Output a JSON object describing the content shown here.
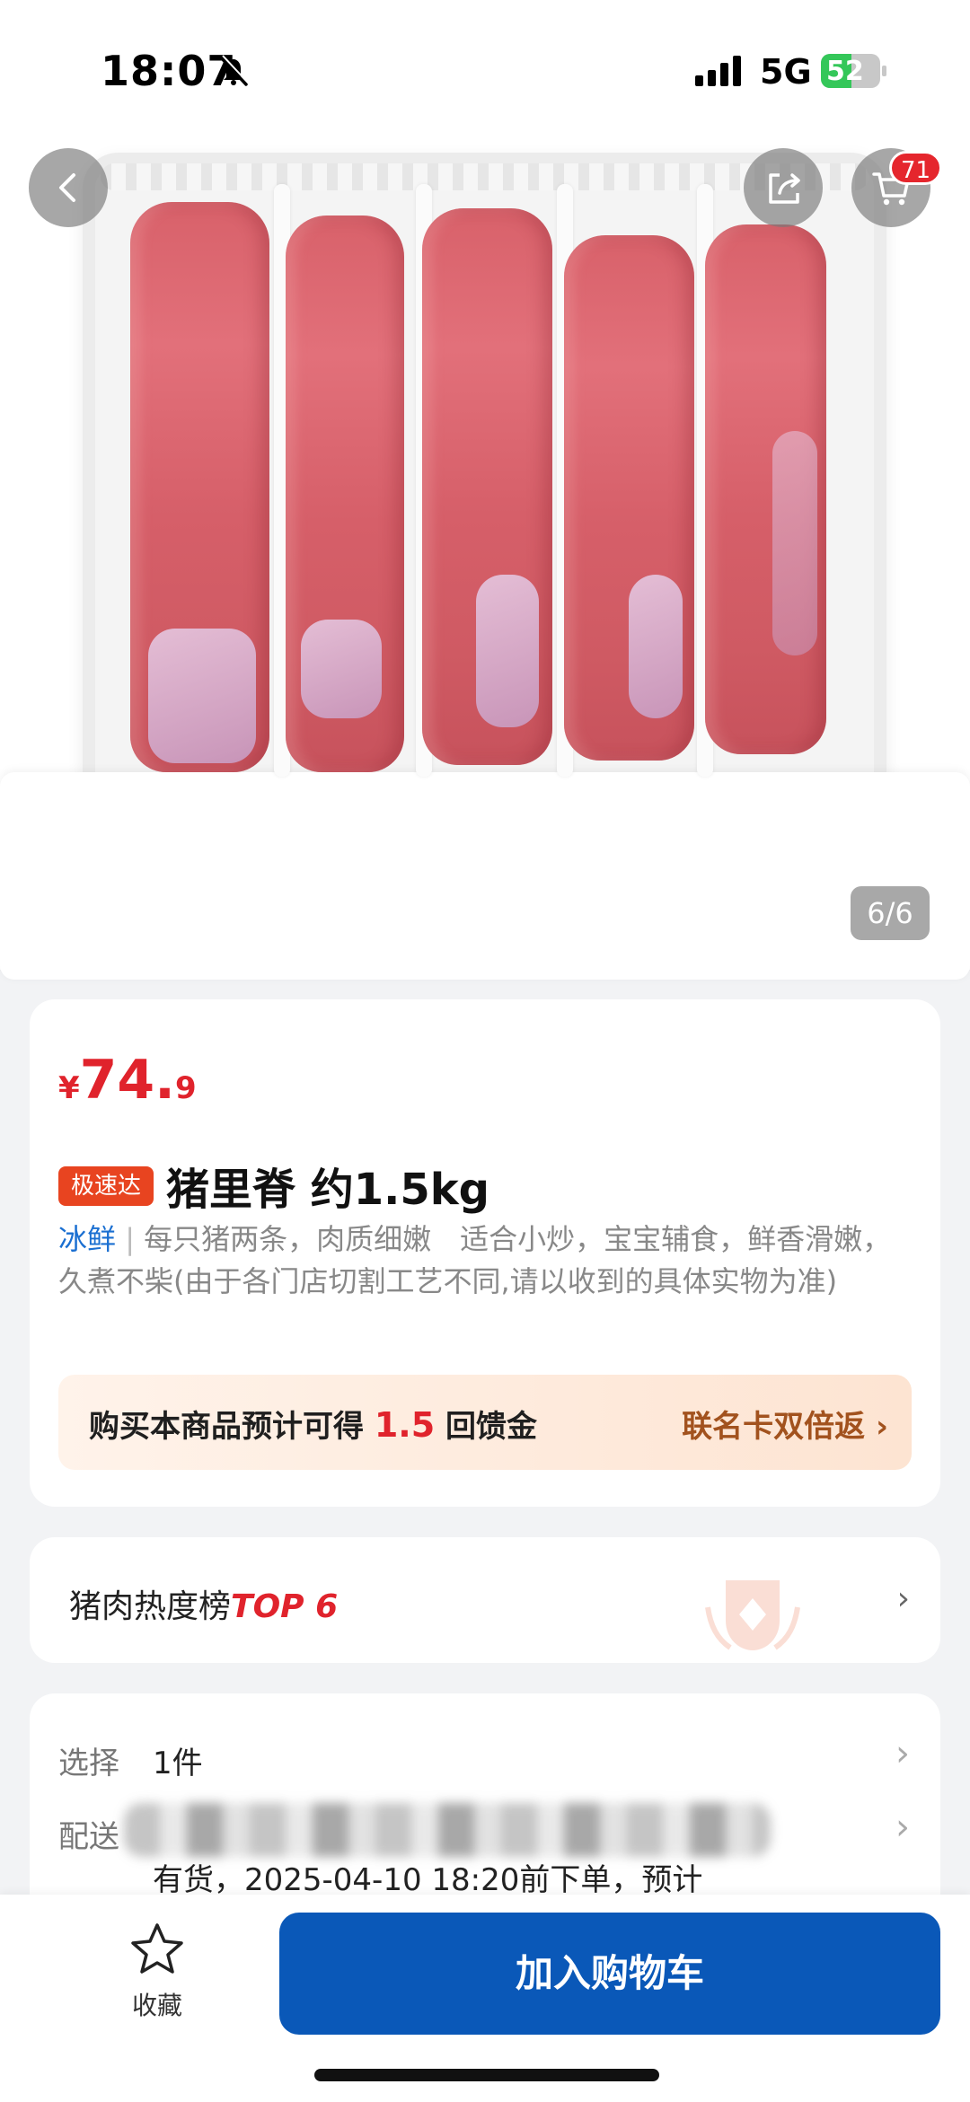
{
  "status_bar": {
    "time": "18:07",
    "network": "5G",
    "battery_level": 52,
    "battery_text": "52"
  },
  "gallery": {
    "cart_badge": "71",
    "counter": "6/6",
    "image_current": 6,
    "image_total": 6
  },
  "product": {
    "price_currency": "¥",
    "price_int": "74.",
    "price_dec": "9",
    "speed_tag": "极速达",
    "title": "猪里脊 约1.5kg",
    "fresh_label": "冰鲜",
    "separator": "|",
    "description": "每只猪两条，肉质细嫩　适合小炒，宝宝辅食，鲜香滑嫩，久煮不柴(由于各门店切割工艺不同,请以收到的具体实物为准)"
  },
  "cashback": {
    "prefix": "购买本商品预计可得",
    "amount": "1.5",
    "suffix": "回馈金",
    "link": "联名卡双倍返"
  },
  "ranking": {
    "label": "猪肉热度榜",
    "top": "TOP 6"
  },
  "options": {
    "select_label": "选择",
    "select_value": "1件",
    "delivery_label": "配送",
    "delivery_value": "有货，2025-04-10 18:20前下单，预计"
  },
  "bottom_bar": {
    "favorite_label": "收藏",
    "add_to_cart": "加入购物车"
  },
  "colors": {
    "accent_red": "#e0232c",
    "primary_blue": "#0a58b8",
    "fresh_blue": "#1a6fd1",
    "tag_orange": "#e84420"
  }
}
